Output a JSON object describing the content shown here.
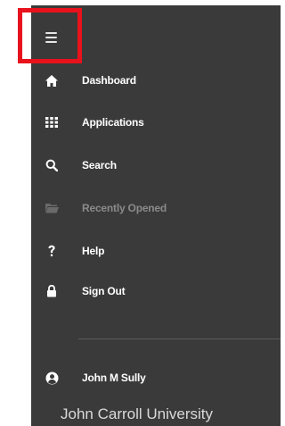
{
  "menu": {
    "toggle_icon": "hamburger-icon",
    "items": [
      {
        "label": "Dashboard",
        "icon": "home-icon"
      },
      {
        "label": "Applications",
        "icon": "grid-icon"
      },
      {
        "label": "Search",
        "icon": "search-icon"
      },
      {
        "label": "Recently Opened",
        "icon": "folder-icon"
      },
      {
        "label": "Help",
        "icon": "question-icon"
      },
      {
        "label": "Sign Out",
        "icon": "lock-icon"
      }
    ]
  },
  "user": {
    "name": "John M Sully",
    "icon": "user-circle-icon"
  },
  "footer": {
    "university": "John Carroll University"
  },
  "colors": {
    "sidebar_bg": "#3a3a3a",
    "highlight": "#e8121d",
    "text": "#ffffff",
    "disabled_text": "#8a8a8a"
  }
}
